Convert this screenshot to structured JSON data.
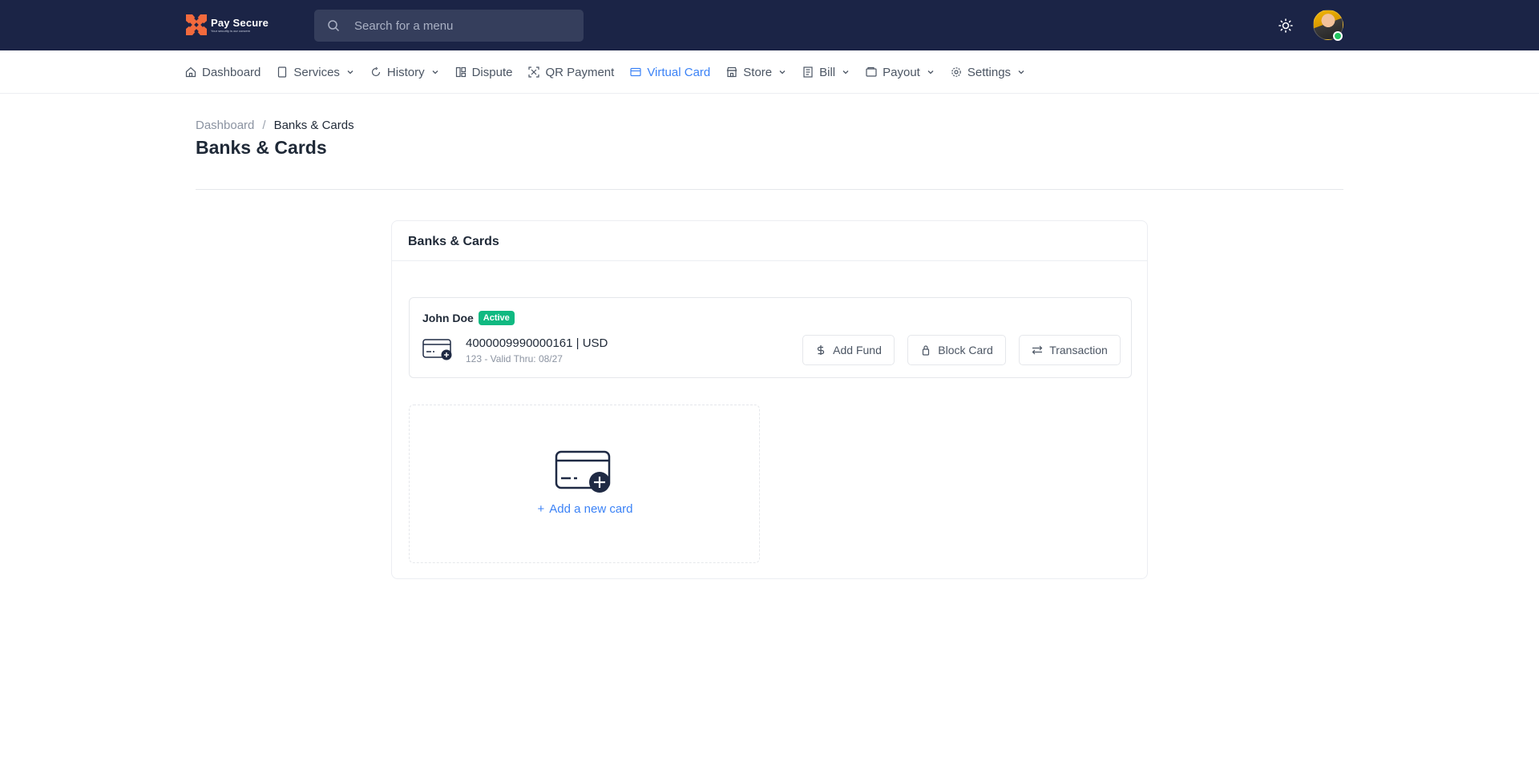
{
  "brand": {
    "name": "Pay Secure",
    "tagline": "Your security is our concern",
    "accent": "#f26a3d",
    "topbar_bg": "#1b2446"
  },
  "search": {
    "placeholder": "Search for a menu",
    "value": ""
  },
  "topbar": {
    "theme_icon": "sun-icon",
    "avatar_status": "online"
  },
  "nav": {
    "items": [
      {
        "label": "Dashboard",
        "icon": "home-icon",
        "dropdown": false,
        "active": false
      },
      {
        "label": "Services",
        "icon": "document-icon",
        "dropdown": true,
        "active": false
      },
      {
        "label": "History",
        "icon": "refresh-icon",
        "dropdown": true,
        "active": false
      },
      {
        "label": "Dispute",
        "icon": "columns-icon",
        "dropdown": false,
        "active": false
      },
      {
        "label": "QR Payment",
        "icon": "qr-scan-icon",
        "dropdown": false,
        "active": false
      },
      {
        "label": "Virtual Card",
        "icon": "credit-card-icon",
        "dropdown": false,
        "active": true
      },
      {
        "label": "Store",
        "icon": "store-icon",
        "dropdown": true,
        "active": false
      },
      {
        "label": "Bill",
        "icon": "receipt-icon",
        "dropdown": true,
        "active": false
      },
      {
        "label": "Payout",
        "icon": "wallet-icon",
        "dropdown": true,
        "active": false
      },
      {
        "label": "Settings",
        "icon": "gear-icon",
        "dropdown": true,
        "active": false
      }
    ],
    "active_color": "#3b82f6"
  },
  "breadcrumb": {
    "parent": "Dashboard",
    "separator": "/",
    "current": "Banks & Cards"
  },
  "page": {
    "title": "Banks & Cards"
  },
  "panel": {
    "title": "Banks & Cards",
    "card": {
      "holder": "John Doe",
      "status": "Active",
      "status_color": "#10b981",
      "number": "4000009990000161 | USD",
      "meta": "123 - Valid Thru: 08/27"
    },
    "actions": {
      "add_fund": "Add Fund",
      "block_card": "Block Card",
      "transaction": "Transaction"
    },
    "add_card": {
      "plus": "+",
      "label": "Add a new card"
    }
  }
}
